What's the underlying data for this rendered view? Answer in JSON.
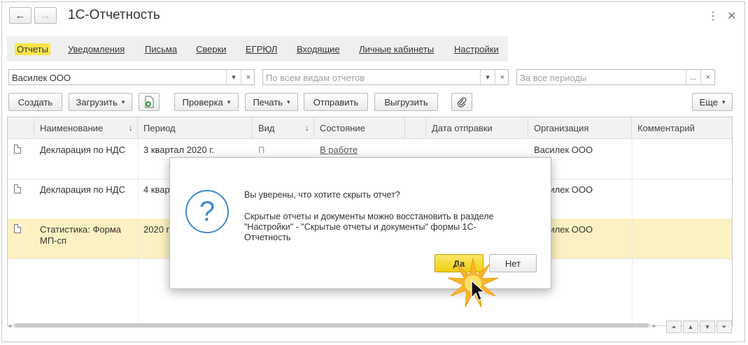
{
  "window": {
    "title": "1С-Отчетность",
    "back_icon": "←",
    "forward_icon": "→",
    "more_icon": "⋮",
    "close_icon": "✕"
  },
  "tabs": [
    "Отчеты",
    "Уведомления",
    "Письма",
    "Сверки",
    "ЕГРЮЛ",
    "Входящие",
    "Личные кабинеты",
    "Настройки"
  ],
  "filters": {
    "organization": "Василек ООО",
    "report_types_placeholder": "По всем видам отчетов",
    "period_placeholder": "За все периоды",
    "dropdown_icon": "▾",
    "clear_icon": "×",
    "select_icon": "..."
  },
  "toolbar": {
    "create": "Создать",
    "load": "Загрузить",
    "check": "Проверка",
    "print": "Печать",
    "send": "Отправить",
    "export": "Выгрузить",
    "more": "Еще",
    "arrow": "▾"
  },
  "table": {
    "columns": [
      "Наименование",
      "Период",
      "Вид",
      "Состояние",
      "Дата отправки",
      "Организация",
      "Комментарий"
    ],
    "sort_icon": "↓",
    "rows": [
      {
        "name": "Декларация по НДС",
        "period": "3 квартал 2020 г.",
        "kind": "П",
        "state": "В работе",
        "org": "Василек ООО"
      },
      {
        "name": "Декларация по НДС",
        "period": "4 квар",
        "kind": "",
        "state": "",
        "org": "Василек ООО"
      },
      {
        "name_line1": "Статистика: Форма",
        "name_line2": "МП-сп",
        "period": "2020 г",
        "kind": "",
        "state": "",
        "org": "Василек ООО"
      }
    ]
  },
  "pager": {
    "first": "⏶",
    "prev": "▲",
    "next": "▼",
    "last": "⏷",
    "left": "◂",
    "right": "▸"
  },
  "dialog": {
    "question_icon": "?",
    "question": "Вы уверены, что хотите скрыть отчет?",
    "info_line1": "Скрытые отчеты и документы можно восстановить в разделе",
    "info_line2": "\"Настройки\" - \"Скрытые отчеты и документы\" формы 1С-",
    "info_line3": "Отчетность",
    "yes": "Да",
    "no": "Нет"
  }
}
